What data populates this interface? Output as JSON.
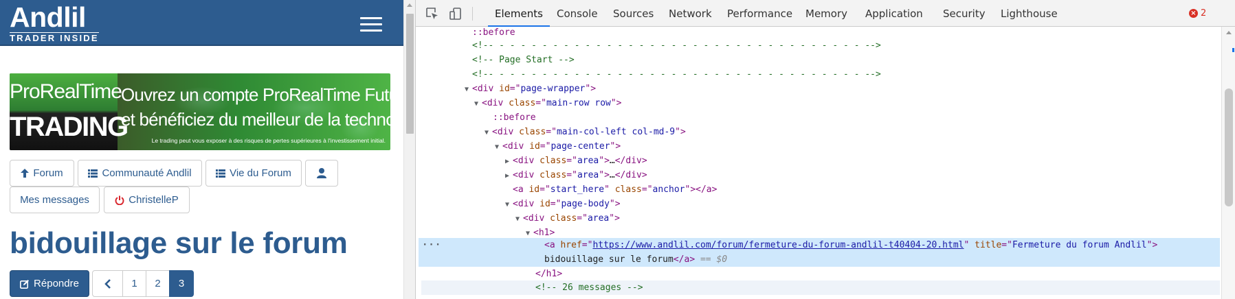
{
  "site": {
    "logo": {
      "name": "Andlil",
      "tagline": "TRADER INSIDE"
    },
    "banner": {
      "brand_top": "ProRealTime",
      "brand_bottom": "TRADING",
      "line1": "Ouvrez un compte ProRealTime Futures & Actions",
      "line2": "et bénéficiez du meilleur de la technologie",
      "disclaimer": "Le trading peut vous exposer à des risques de pertes supérieures à l'investissement initial."
    },
    "nav": {
      "forum": "Forum",
      "community": "Communauté Andlil",
      "forum_life": "Vie du Forum",
      "messages": "Mes messages",
      "user": "ChristelleP"
    },
    "title": "bidouillage sur le forum",
    "reply": "Répondre",
    "pages": [
      "1",
      "2",
      "3"
    ],
    "current_page": "3"
  },
  "devtools": {
    "tabs": [
      "Elements",
      "Console",
      "Sources",
      "Network",
      "Performance",
      "Memory",
      "Application",
      "Security",
      "Lighthouse"
    ],
    "active_tab": "Elements",
    "error_count": "2",
    "dom": {
      "before1": "::before",
      "comment_dash": "<!-- - - - - - - - - - - - - - - - - - - - - - - - - - - - - - - - - - - -->",
      "comment_page_start": "<!-- Page Start -->",
      "page_wrapper_id": "page-wrapper",
      "main_row_class": "main-row row",
      "before2": "::before",
      "main_col_class": "main-col-left col-md-9",
      "page_center_id": "page-center",
      "area_class": "area",
      "start_here_id": "start_here",
      "anchor_class": "anchor",
      "page_body_id": "page-body",
      "h1": "h1",
      "link_href": "https://www.andlil.com/forum/fermeture-du-forum-andlil-t40404-20.html",
      "link_title": "Fermeture du forum Andlil",
      "link_text": "bidouillage sur le forum",
      "selected_marker": "== $0",
      "messages_comment": "<!-- 26 messages -->"
    }
  }
}
